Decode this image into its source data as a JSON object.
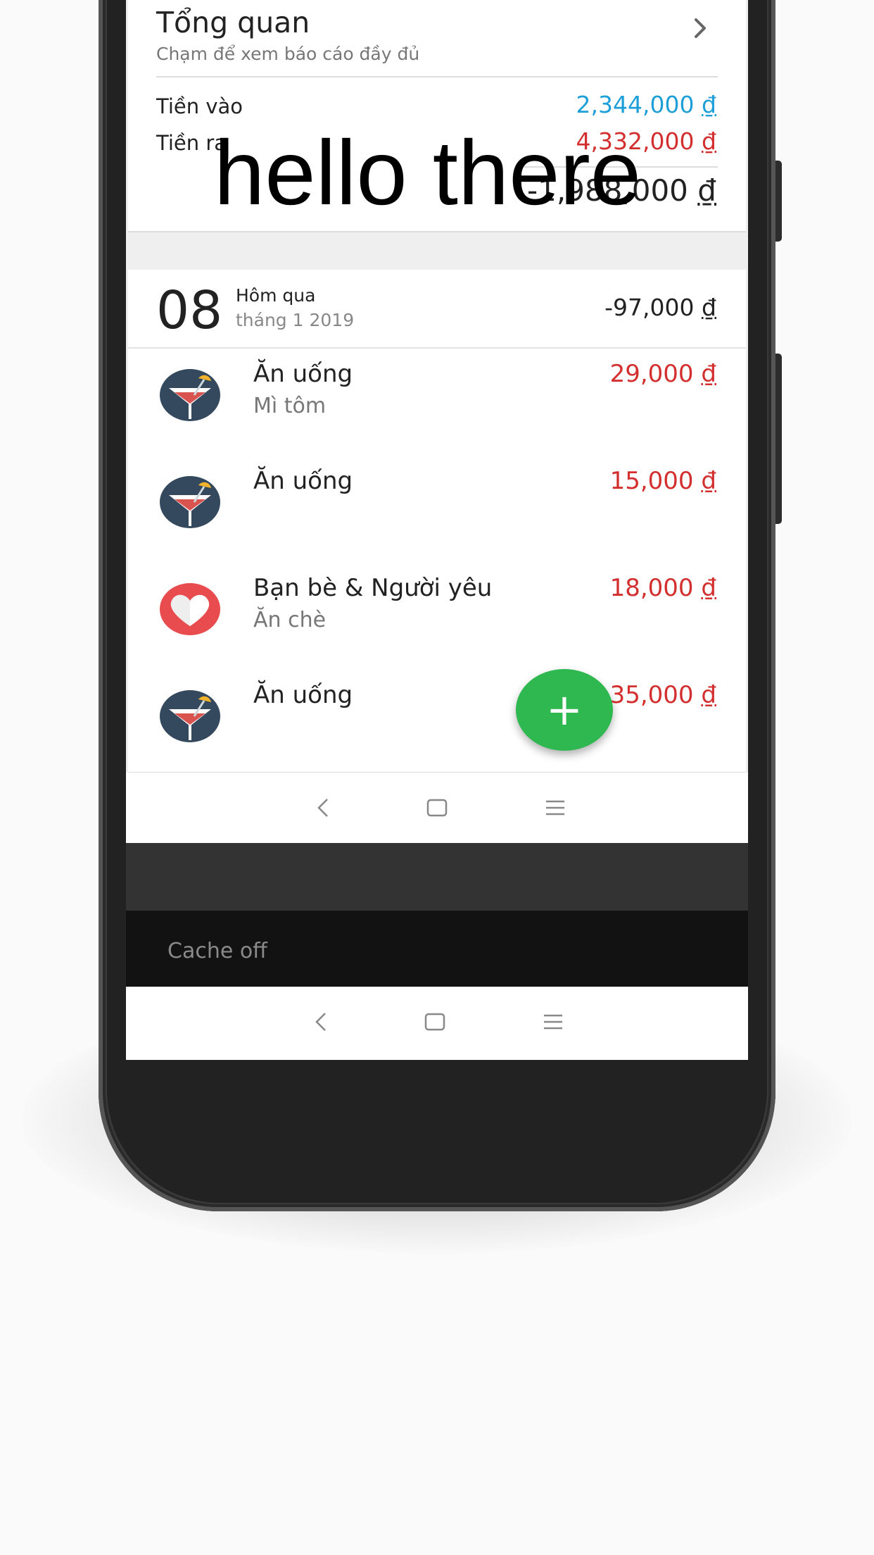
{
  "overlay_text": "hello there",
  "overview": {
    "title": "Tổng quan",
    "subtitle": "Chạm để xem báo cáo đầy đủ",
    "income_label": "Tiền vào",
    "income_value": "2,344,000",
    "expense_label": "Tiền ra",
    "expense_value": "4,332,000",
    "total_value": "-1,988,000",
    "currency": "₫"
  },
  "day": {
    "number": "08",
    "label": "Hôm qua",
    "month": "tháng 1 2019",
    "total": "-97,000"
  },
  "transactions": [
    {
      "category": "Ăn uống",
      "note": "Mì tôm",
      "amount": "29,000",
      "icon": "cocktail-icon"
    },
    {
      "category": "Ăn uống",
      "note": "",
      "amount": "15,000",
      "icon": "cocktail-icon"
    },
    {
      "category": "Bạn bè & Người yêu",
      "note": "Ăn chè",
      "amount": "18,000",
      "icon": "heart-icon"
    },
    {
      "category": "Ăn uống",
      "note": "",
      "amount": "35,000",
      "icon": "cocktail-icon"
    }
  ],
  "fab_label": "+",
  "cache_status": "Cache off",
  "colors": {
    "income": "#1e9fd8",
    "expense": "#d32f2f",
    "fab": "#2fb84f",
    "icon_bg": "#34495e",
    "heart_bg": "#e84c4f"
  }
}
